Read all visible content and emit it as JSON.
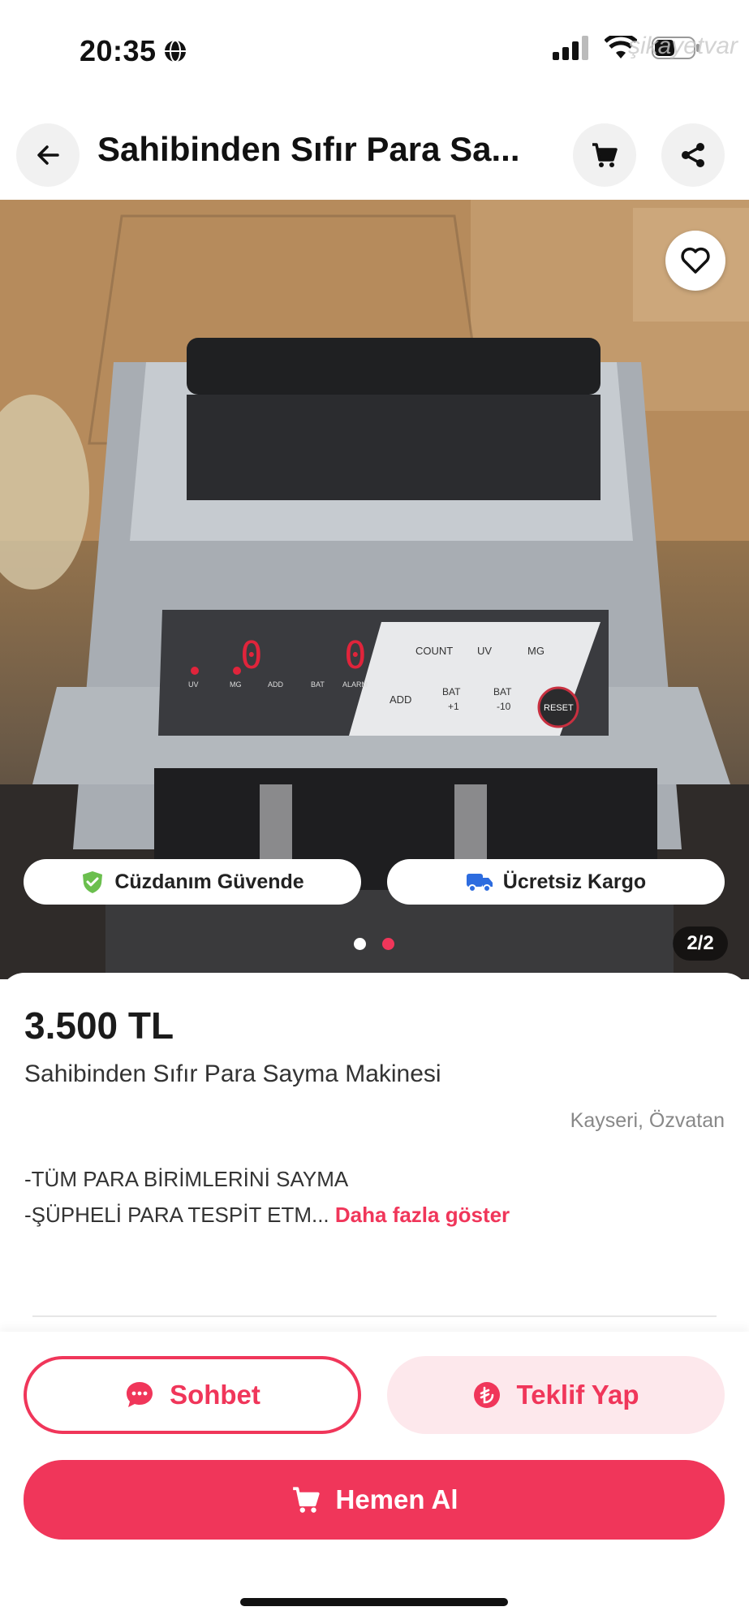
{
  "status_bar": {
    "time": "20:35",
    "watermark": "şikayetvar"
  },
  "header": {
    "title": "Sahibinden Sıfır Para Sa...",
    "back_icon": "arrow-left-icon",
    "cart_icon": "cart-icon",
    "share_icon": "share-icon"
  },
  "gallery": {
    "badges": [
      {
        "label": "Cüzdanım Güvende",
        "icon": "shield-check-icon",
        "color": "#6bbf4e"
      },
      {
        "label": "Ücretsiz Kargo",
        "icon": "truck-icon",
        "color": "#2d6cdf"
      }
    ],
    "page_counter": "2/2",
    "active_index": 2,
    "total": 2,
    "device_labels": {
      "count": "COUNT",
      "uv": "UV",
      "mg": "MG",
      "add": "ADD",
      "bat_plus": "BAT",
      "plus_one": "+1",
      "bat_minus": "BAT",
      "minus_ten": "-10",
      "reset": "RESET",
      "led_uv": "UV",
      "led_mg": "MG",
      "led_add": "ADD",
      "led_bat": "BAT",
      "led_alarm": "ALARM",
      "digit_left": "0",
      "digit_right": "0"
    }
  },
  "listing": {
    "price": "3.500 TL",
    "title": "Sahibinden Sıfır Para Sayma Makinesi",
    "location": "Kayseri, Özvatan",
    "description_line1": "-TÜM PARA BİRİMLERİNİ SAYMA",
    "description_line2": "-ŞÜPHELİ PARA TESPİT ETM...",
    "more_link": "Daha fazla göster"
  },
  "actions": {
    "chat_label": "Sohbet",
    "offer_label": "Teklif Yap",
    "buy_label": "Hemen Al"
  },
  "colors": {
    "accent": "#f0365a",
    "accent_light": "#fde8ec"
  }
}
